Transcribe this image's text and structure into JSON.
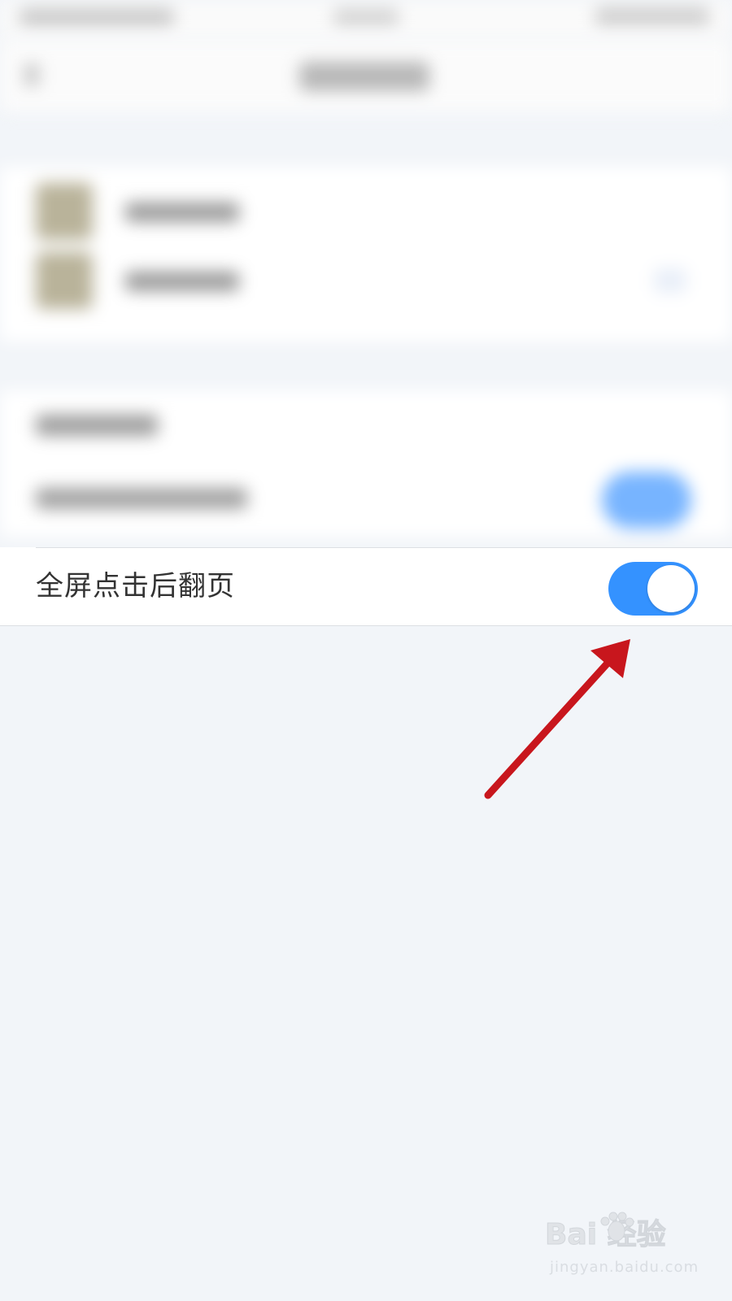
{
  "setting": {
    "label": "全屏点击后翻页",
    "toggle_on": true
  },
  "colors": {
    "toggle_on": "#3492ff",
    "background": "#f2f5f9",
    "annotation_arrow": "#c8161d"
  },
  "watermark": {
    "logo_text": "Bai 经验",
    "url": "jingyan.baidu.com"
  }
}
